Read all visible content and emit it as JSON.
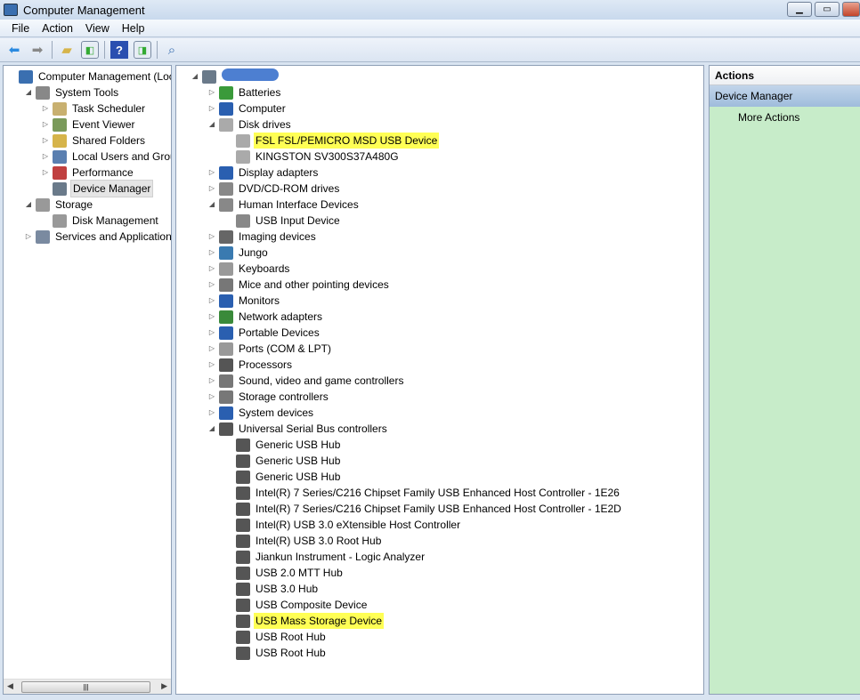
{
  "window": {
    "title": "Computer Management",
    "controls": [
      "minimize",
      "restore",
      "close"
    ]
  },
  "menu": [
    "File",
    "Action",
    "View",
    "Help"
  ],
  "toolbar": [
    "back-icon",
    "forward-icon",
    "up-folder-icon",
    "show-hide-tree-icon",
    "help-icon",
    "show-hide-action-pane-icon",
    "properties-icon"
  ],
  "left_tree": [
    {
      "label": "Computer Management (Local",
      "level": 0,
      "exp": "",
      "icon": "computer-icon",
      "color": "#3a6fb0"
    },
    {
      "label": "System Tools",
      "level": 1,
      "exp": "open",
      "icon": "tools-icon",
      "color": "#888"
    },
    {
      "label": "Task Scheduler",
      "level": 2,
      "exp": "closed",
      "icon": "clock-icon",
      "color": "#c8b070"
    },
    {
      "label": "Event Viewer",
      "level": 2,
      "exp": "closed",
      "icon": "event-viewer-icon",
      "color": "#7a9a5a"
    },
    {
      "label": "Shared Folders",
      "level": 2,
      "exp": "closed",
      "icon": "shared-folder-icon",
      "color": "#d6b44a"
    },
    {
      "label": "Local Users and Groups",
      "level": 2,
      "exp": "closed",
      "icon": "users-icon",
      "color": "#5a7fb0"
    },
    {
      "label": "Performance",
      "level": 2,
      "exp": "closed",
      "icon": "performance-icon",
      "color": "#c04040"
    },
    {
      "label": "Device Manager",
      "level": 2,
      "exp": "",
      "icon": "device-manager-icon",
      "color": "#6a7a8a",
      "selected": true
    },
    {
      "label": "Storage",
      "level": 1,
      "exp": "open",
      "icon": "storage-icon",
      "color": "#999"
    },
    {
      "label": "Disk Management",
      "level": 2,
      "exp": "",
      "icon": "disk-icon",
      "color": "#999"
    },
    {
      "label": "Services and Applications",
      "level": 1,
      "exp": "closed",
      "icon": "services-icon",
      "color": "#7a8aa0"
    }
  ],
  "device_tree": [
    {
      "label": "",
      "level": 0,
      "exp": "open",
      "icon": "computer-icon",
      "color": "#6a7a8a",
      "redacted": true
    },
    {
      "label": "Batteries",
      "level": 1,
      "exp": "closed",
      "icon": "battery-icon",
      "color": "#3a9a3a"
    },
    {
      "label": "Computer",
      "level": 1,
      "exp": "closed",
      "icon": "computer-icon",
      "color": "#2a5fb0"
    },
    {
      "label": "Disk drives",
      "level": 1,
      "exp": "open",
      "icon": "disk-drive-icon",
      "color": "#aaa"
    },
    {
      "label": "FSL FSL/PEMICRO MSD USB Device",
      "level": 2,
      "icon": "disk-drive-icon",
      "color": "#aaa",
      "highlight": true
    },
    {
      "label": "KINGSTON SV300S37A480G",
      "level": 2,
      "icon": "disk-drive-icon",
      "color": "#aaa"
    },
    {
      "label": "Display adapters",
      "level": 1,
      "exp": "closed",
      "icon": "display-icon",
      "color": "#2a5fb0"
    },
    {
      "label": "DVD/CD-ROM drives",
      "level": 1,
      "exp": "closed",
      "icon": "dvd-icon",
      "color": "#888"
    },
    {
      "label": "Human Interface Devices",
      "level": 1,
      "exp": "open",
      "icon": "hid-icon",
      "color": "#888"
    },
    {
      "label": "USB Input Device",
      "level": 2,
      "icon": "hid-icon",
      "color": "#888"
    },
    {
      "label": "Imaging devices",
      "level": 1,
      "exp": "closed",
      "icon": "camera-icon",
      "color": "#666"
    },
    {
      "label": "Jungo",
      "level": 1,
      "exp": "closed",
      "icon": "jungo-icon",
      "color": "#3a7ab0"
    },
    {
      "label": "Keyboards",
      "level": 1,
      "exp": "closed",
      "icon": "keyboard-icon",
      "color": "#999"
    },
    {
      "label": "Mice and other pointing devices",
      "level": 1,
      "exp": "closed",
      "icon": "mouse-icon",
      "color": "#777"
    },
    {
      "label": "Monitors",
      "level": 1,
      "exp": "closed",
      "icon": "monitor-icon",
      "color": "#2a5fb0"
    },
    {
      "label": "Network adapters",
      "level": 1,
      "exp": "closed",
      "icon": "network-icon",
      "color": "#3a8a3a"
    },
    {
      "label": "Portable Devices",
      "level": 1,
      "exp": "closed",
      "icon": "portable-device-icon",
      "color": "#2a5fb0"
    },
    {
      "label": "Ports (COM & LPT)",
      "level": 1,
      "exp": "closed",
      "icon": "port-icon",
      "color": "#999"
    },
    {
      "label": "Processors",
      "level": 1,
      "exp": "closed",
      "icon": "processor-icon",
      "color": "#555"
    },
    {
      "label": "Sound, video and game controllers",
      "level": 1,
      "exp": "closed",
      "icon": "speaker-icon",
      "color": "#777"
    },
    {
      "label": "Storage controllers",
      "level": 1,
      "exp": "closed",
      "icon": "storage-controller-icon",
      "color": "#777"
    },
    {
      "label": "System devices",
      "level": 1,
      "exp": "closed",
      "icon": "system-device-icon",
      "color": "#2a5fb0"
    },
    {
      "label": "Universal Serial Bus controllers",
      "level": 1,
      "exp": "open",
      "icon": "usb-icon",
      "color": "#555"
    },
    {
      "label": "Generic USB Hub",
      "level": 2,
      "icon": "usb-icon",
      "color": "#555"
    },
    {
      "label": "Generic USB Hub",
      "level": 2,
      "icon": "usb-icon",
      "color": "#555"
    },
    {
      "label": "Generic USB Hub",
      "level": 2,
      "icon": "usb-icon",
      "color": "#555"
    },
    {
      "label": "Intel(R) 7 Series/C216 Chipset Family USB Enhanced Host Controller - 1E26",
      "level": 2,
      "icon": "usb-icon",
      "color": "#555"
    },
    {
      "label": "Intel(R) 7 Series/C216 Chipset Family USB Enhanced Host Controller - 1E2D",
      "level": 2,
      "icon": "usb-icon",
      "color": "#555"
    },
    {
      "label": "Intel(R) USB 3.0 eXtensible Host Controller",
      "level": 2,
      "icon": "usb-icon",
      "color": "#555"
    },
    {
      "label": "Intel(R) USB 3.0 Root Hub",
      "level": 2,
      "icon": "usb-icon",
      "color": "#555"
    },
    {
      "label": "Jiankun Instrument - Logic Analyzer",
      "level": 2,
      "icon": "usb-icon",
      "color": "#555"
    },
    {
      "label": "USB 2.0 MTT Hub",
      "level": 2,
      "icon": "usb-icon",
      "color": "#555"
    },
    {
      "label": "USB 3.0 Hub",
      "level": 2,
      "icon": "usb-icon",
      "color": "#555"
    },
    {
      "label": "USB Composite Device",
      "level": 2,
      "icon": "usb-icon",
      "color": "#555"
    },
    {
      "label": "USB Mass Storage Device",
      "level": 2,
      "icon": "usb-icon",
      "color": "#555",
      "highlight": true
    },
    {
      "label": "USB Root Hub",
      "level": 2,
      "icon": "usb-icon",
      "color": "#555"
    },
    {
      "label": "USB Root Hub",
      "level": 2,
      "icon": "usb-icon",
      "color": "#555"
    }
  ],
  "actions": {
    "title": "Actions",
    "section": "Device Manager",
    "items": [
      "More Actions"
    ]
  },
  "colors": {
    "highlight": "#ffff55",
    "actions_bg": "#c7ecc9"
  }
}
